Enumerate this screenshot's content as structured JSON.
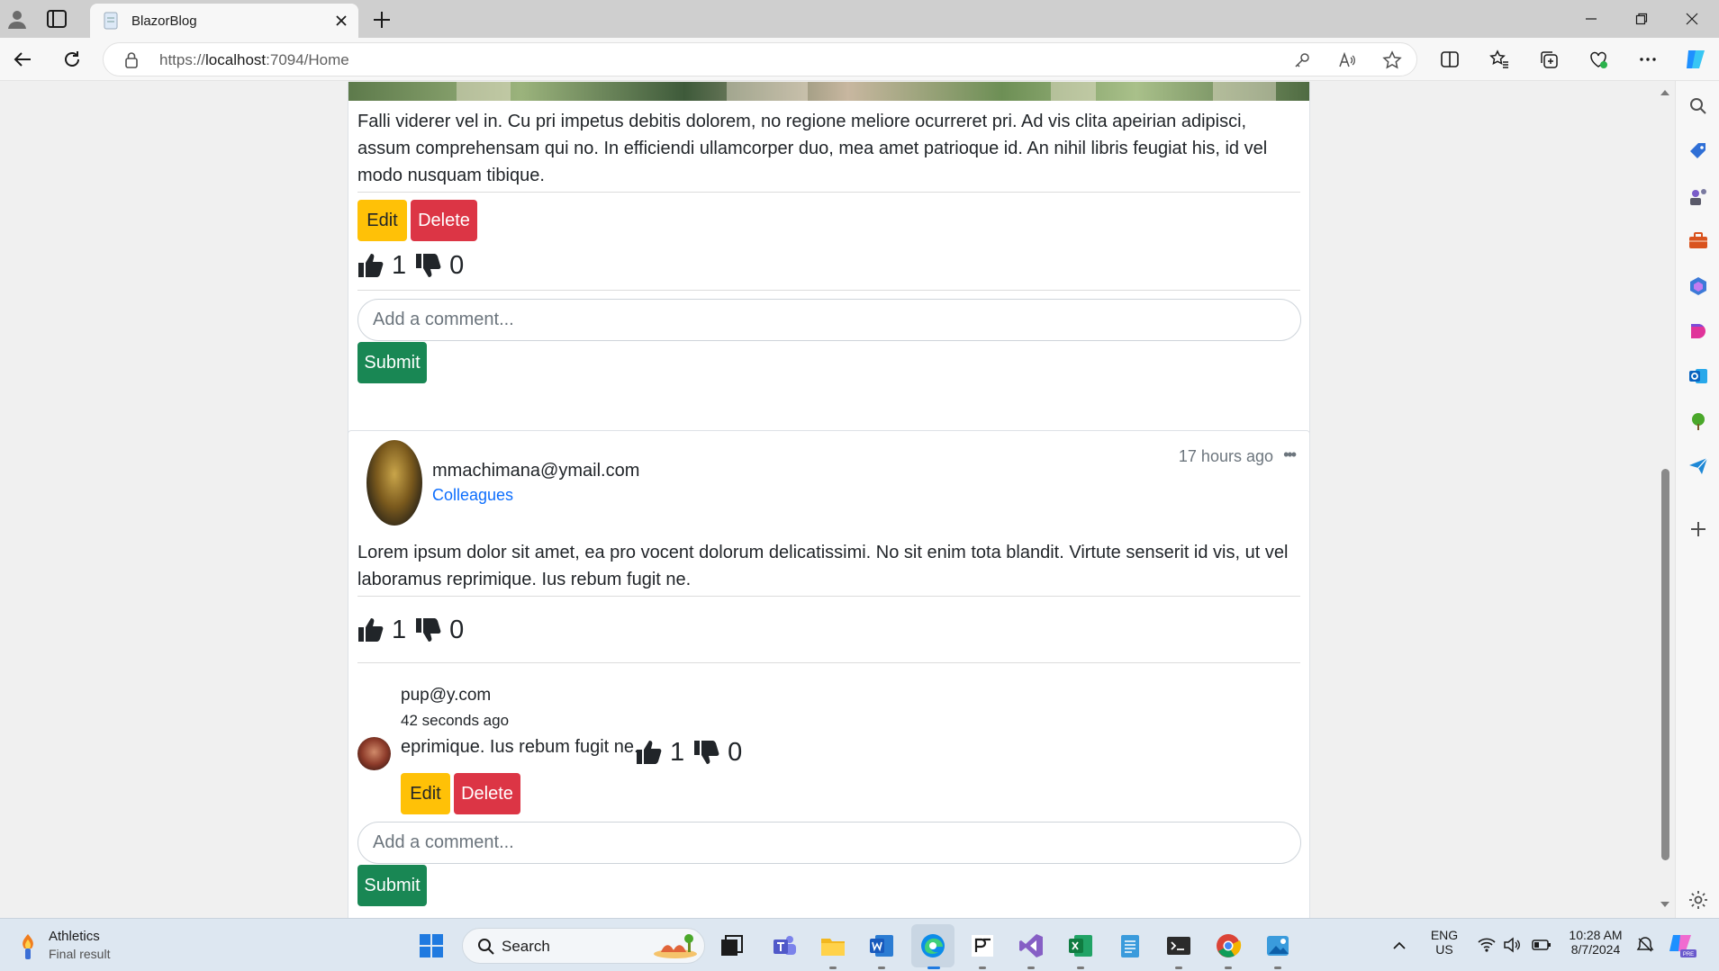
{
  "browser": {
    "tab_title": "BlazorBlog",
    "url_host": "https://",
    "url_main": "localhost",
    "url_rest": ":7094/Home"
  },
  "post1": {
    "body": "Falli viderer vel in. Cu pri impetus debitis dolorem, no regione meliore ocurreret pri. Ad vis clita apeirian adipisci, assum comprehensam qui no. In efficiendi ullamcorper duo, mea amet patrioque id. An nihil libris feugiat his, id vel modo nusquam tibique.",
    "edit_label": "Edit",
    "delete_label": "Delete",
    "likes": "1",
    "dislikes": "0",
    "comment_placeholder": "Add a comment...",
    "submit_label": "Submit"
  },
  "post2": {
    "author": "mmachimana@ymail.com",
    "group": "Colleagues",
    "time_ago": "17 hours ago",
    "more": "•••",
    "body": "Lorem ipsum dolor sit amet, ea pro vocent dolorum delicatissimi. No sit enim tota blandit. Virtute senserit id vis, ut vel laboramus reprimique. Ius rebum fugit ne.",
    "likes": "1",
    "dislikes": "0",
    "comment": {
      "author": "pup@y.com",
      "time_ago": "42 seconds ago",
      "text": "eprimique. Ius rebum fugit ne.",
      "likes": "1",
      "dislikes": "0",
      "edit_label": "Edit",
      "delete_label": "Delete"
    },
    "comment_placeholder": "Add a comment...",
    "submit_label": "Submit"
  },
  "taskbar": {
    "weather_title": "Athletics",
    "weather_sub": "Final result",
    "search_label": "Search",
    "lang_top": "ENG",
    "lang_bottom": "US",
    "time": "10:28 AM",
    "date": "8/7/2024"
  },
  "colors": {
    "warning": "#ffc107",
    "danger": "#dc3545",
    "success": "#198754",
    "link": "#0d6efd"
  }
}
